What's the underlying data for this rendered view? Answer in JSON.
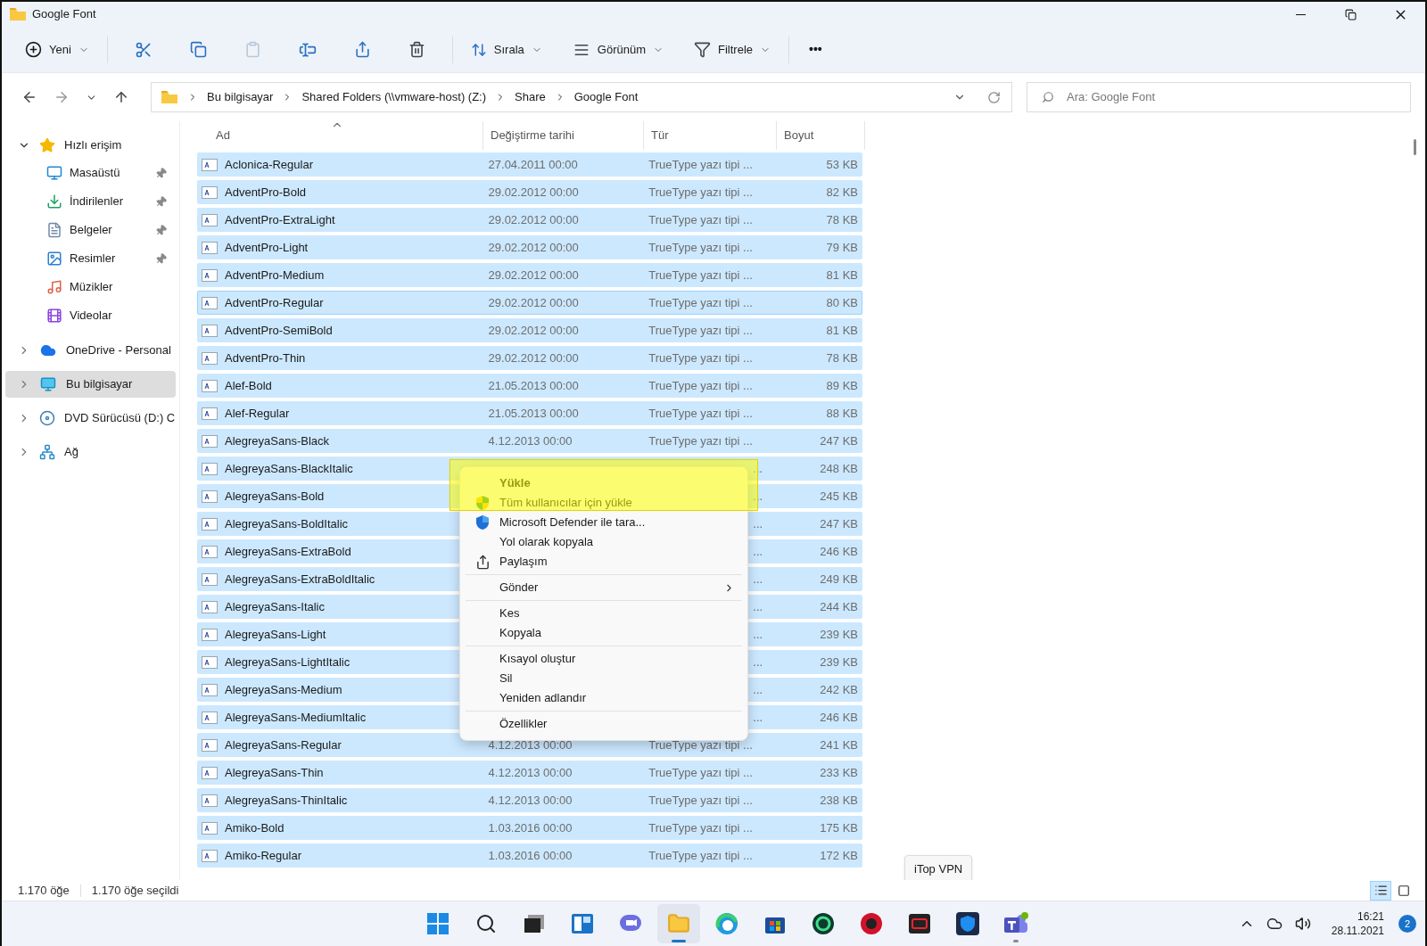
{
  "window": {
    "title": "Google Font"
  },
  "toolbar": {
    "new_label": "Yeni",
    "sort_label": "Sırala",
    "view_label": "Görünüm",
    "filter_label": "Filtrele",
    "more_label": "•••",
    "paste_disabled": true
  },
  "address": {
    "crumbs": [
      "Bu bilgisayar",
      "Shared Folders (\\\\vmware-host) (Z:)",
      "Share",
      "Google Font"
    ],
    "search_placeholder": "Ara: Google Font"
  },
  "sidebar": [
    {
      "label": "Hızlı erişim",
      "expanded": true,
      "selected": false,
      "children": [
        {
          "label": "Masaüstü",
          "pinned": true,
          "selected": false
        },
        {
          "label": "İndirilenler",
          "pinned": true,
          "selected": false
        },
        {
          "label": "Belgeler",
          "pinned": true,
          "selected": false
        },
        {
          "label": "Resimler",
          "pinned": true,
          "selected": false
        },
        {
          "label": "Müzikler",
          "pinned": false,
          "selected": false
        },
        {
          "label": "Videolar",
          "pinned": false,
          "selected": false
        }
      ]
    },
    {
      "label": "OneDrive - Personal",
      "expanded": false,
      "selected": false
    },
    {
      "label": "Bu bilgisayar",
      "expanded": false,
      "selected": true
    },
    {
      "label": "DVD Sürücüsü (D:) C",
      "expanded": false,
      "selected": false
    },
    {
      "label": "Ağ",
      "expanded": false,
      "selected": false
    }
  ],
  "table": {
    "columns": [
      "Ad",
      "Değiştirme tarihi",
      "Tür",
      "Boyut"
    ],
    "rows": [
      {
        "name": "Aclonica-Regular",
        "date": "27.04.2011 00:00",
        "type": "TrueType yazı tipi ...",
        "size": "53 KB",
        "selected": true,
        "focused": false
      },
      {
        "name": "AdventPro-Bold",
        "date": "29.02.2012 00:00",
        "type": "TrueType yazı tipi ...",
        "size": "82 KB",
        "selected": true,
        "focused": false
      },
      {
        "name": "AdventPro-ExtraLight",
        "date": "29.02.2012 00:00",
        "type": "TrueType yazı tipi ...",
        "size": "78 KB",
        "selected": true,
        "focused": false
      },
      {
        "name": "AdventPro-Light",
        "date": "29.02.2012 00:00",
        "type": "TrueType yazı tipi ...",
        "size": "79 KB",
        "selected": true,
        "focused": false
      },
      {
        "name": "AdventPro-Medium",
        "date": "29.02.2012 00:00",
        "type": "TrueType yazı tipi ...",
        "size": "81 KB",
        "selected": true,
        "focused": false
      },
      {
        "name": "AdventPro-Regular",
        "date": "29.02.2012 00:00",
        "type": "TrueType yazı tipi ...",
        "size": "80 KB",
        "selected": true,
        "focused": true
      },
      {
        "name": "AdventPro-SemiBold",
        "date": "29.02.2012 00:00",
        "type": "TrueType yazı tipi ...",
        "size": "81 KB",
        "selected": true,
        "focused": false
      },
      {
        "name": "AdventPro-Thin",
        "date": "29.02.2012 00:00",
        "type": "TrueType yazı tipi ...",
        "size": "78 KB",
        "selected": true,
        "focused": false
      },
      {
        "name": "Alef-Bold",
        "date": "21.05.2013 00:00",
        "type": "TrueType yazı tipi ...",
        "size": "89 KB",
        "selected": true,
        "focused": false
      },
      {
        "name": "Alef-Regular",
        "date": "21.05.2013 00:00",
        "type": "TrueType yazı tipi ...",
        "size": "88 KB",
        "selected": true,
        "focused": false
      },
      {
        "name": "AlegreyaSans-Black",
        "date": "4.12.2013 00:00",
        "type": "TrueType yazı tipi ...",
        "size": "247 KB",
        "selected": true,
        "focused": false
      },
      {
        "name": "AlegreyaSans-BlackItalic",
        "type": "...",
        "size": "248 KB",
        "selected": true,
        "focused": false
      },
      {
        "name": "AlegreyaSans-Bold",
        "type": "...",
        "size": "245 KB",
        "selected": true,
        "focused": false
      },
      {
        "name": "AlegreyaSans-BoldItalic",
        "type": "...",
        "size": "247 KB",
        "selected": true,
        "focused": false
      },
      {
        "name": "AlegreyaSans-ExtraBold",
        "type": "...",
        "size": "246 KB",
        "selected": true,
        "focused": false
      },
      {
        "name": "AlegreyaSans-ExtraBoldItalic",
        "type": "...",
        "size": "249 KB",
        "selected": true,
        "focused": false
      },
      {
        "name": "AlegreyaSans-Italic",
        "type": "...",
        "size": "244 KB",
        "selected": true,
        "focused": false
      },
      {
        "name": "AlegreyaSans-Light",
        "type": "...",
        "size": "239 KB",
        "selected": true,
        "focused": false
      },
      {
        "name": "AlegreyaSans-LightItalic",
        "type": "...",
        "size": "239 KB",
        "selected": true,
        "focused": false
      },
      {
        "name": "AlegreyaSans-Medium",
        "type": "...",
        "size": "242 KB",
        "selected": true,
        "focused": false
      },
      {
        "name": "AlegreyaSans-MediumItalic",
        "type": "...",
        "size": "246 KB",
        "selected": true,
        "focused": false
      },
      {
        "name": "AlegreyaSans-Regular",
        "date": "4.12.2013 00:00",
        "type": "TrueType yazı tipi ...",
        "size": "241 KB",
        "selected": true,
        "focused": false
      },
      {
        "name": "AlegreyaSans-Thin",
        "date": "4.12.2013 00:00",
        "type": "TrueType yazı tipi ...",
        "size": "233 KB",
        "selected": true,
        "focused": false
      },
      {
        "name": "AlegreyaSans-ThinItalic",
        "date": "4.12.2013 00:00",
        "type": "TrueType yazı tipi ...",
        "size": "238 KB",
        "selected": true,
        "focused": false
      },
      {
        "name": "Amiko-Bold",
        "date": "1.03.2016 00:00",
        "type": "TrueType yazı tipi ...",
        "size": "175 KB",
        "selected": true,
        "focused": false
      },
      {
        "name": "Amiko-Regular",
        "date": "1.03.2016 00:00",
        "type": "TrueType yazı tipi ...",
        "size": "172 KB",
        "selected": true,
        "focused": false
      }
    ]
  },
  "context_menu": {
    "groups": [
      [
        {
          "label": "Yükle",
          "kind": "default"
        },
        {
          "label": "Tüm kullanıcılar için yükle",
          "kind": "uac"
        },
        {
          "label": "Microsoft Defender ile tara...",
          "kind": "defender"
        },
        {
          "label": "Yol olarak kopyala",
          "kind": "plain"
        },
        {
          "label": "Paylaşım",
          "kind": "share"
        }
      ],
      [
        {
          "label": "Gönder",
          "kind": "submenu"
        }
      ],
      [
        {
          "label": "Kes",
          "kind": "plain"
        },
        {
          "label": "Kopyala",
          "kind": "plain"
        }
      ],
      [
        {
          "label": "Kısayol oluştur",
          "kind": "plain"
        },
        {
          "label": "Sil",
          "kind": "plain"
        },
        {
          "label": "Yeniden adlandır",
          "kind": "plain"
        }
      ],
      [
        {
          "label": "Özellikler",
          "kind": "plain"
        }
      ]
    ]
  },
  "status_bar": {
    "count": "1.170 öğe",
    "selection": "1.170 öğe seçildi",
    "view_buttons": [
      {
        "selected": true
      },
      {
        "selected": false
      }
    ]
  },
  "tooltip": "iTop VPN",
  "taskbar": {
    "apps": [
      {
        "active": false,
        "running": false
      },
      {
        "active": false,
        "running": false
      },
      {
        "active": false,
        "running": false
      },
      {
        "active": false,
        "running": false
      },
      {
        "active": false,
        "running": false
      },
      {
        "active": true,
        "running": true
      },
      {
        "active": false,
        "running": false
      },
      {
        "active": false,
        "running": false
      },
      {
        "active": false,
        "running": false
      },
      {
        "active": false,
        "running": false
      },
      {
        "active": false,
        "running": false
      },
      {
        "active": false,
        "running": false
      },
      {
        "active": false,
        "running": true
      }
    ],
    "time": "16:21",
    "date": "28.11.2021",
    "notifications": "2"
  }
}
